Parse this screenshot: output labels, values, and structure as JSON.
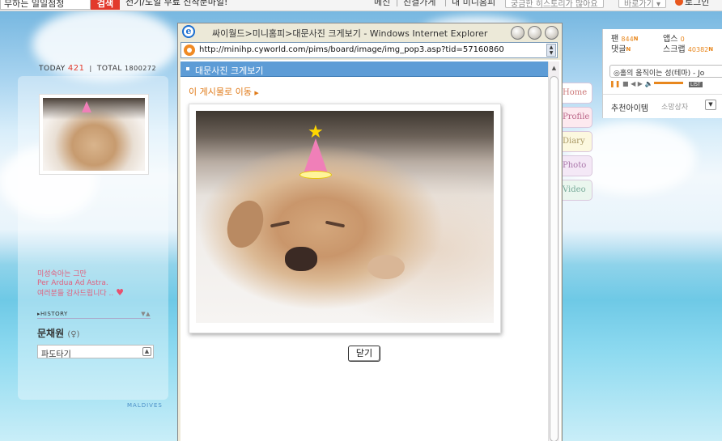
{
  "topbar": {
    "search_value": "무하는 일일점정",
    "search_button": "검색",
    "promo": "전기/도일 무료 신작문마일!",
    "links": [
      "메신",
      "친결가게",
      "내 미니홈피"
    ],
    "story_button": "궁금한 히스토리가 많아요",
    "shortcut_button": "바로가기 ▾",
    "login": "로그인"
  },
  "profile": {
    "today_label": "TODAY",
    "today_count": "421",
    "total_label": "TOTAL",
    "total_count": "1800272",
    "intro_line1": "미성숙아는 그만",
    "intro_line2": "Per Ardua Ad Astra.",
    "intro_line3": "여러분들 감사드립니다 ..",
    "history_label": "HISTORY",
    "owner_name": "문채원",
    "owner_gender": "(♀)",
    "wave_select": "파도타기",
    "skin_label": "MALDIVES"
  },
  "side_tabs": [
    "Home",
    "Profile",
    "Diary",
    "Photo",
    "Video"
  ],
  "right_widget": {
    "fan_label": "팬",
    "fan_count": "844",
    "apps_label": "앱스",
    "apps_count": "0",
    "comment_label": "댓글",
    "scrap_label": "스크랩",
    "scrap_count": "40382",
    "new_badge": "N",
    "bgm_title": "◎홀의 움직이는 성(테마) - Jo",
    "player_list": "LIST",
    "recommend_label": "추천아이템",
    "recommend_sub": "소망상자"
  },
  "popup": {
    "title": "싸이월드>미니홈피>대문사진 크게보기 - Windows Internet Explorer",
    "url": "http://minihp.cyworld.com/pims/board/image/img_pop3.asp?tid=57160860",
    "header": "대문사진 크게보기",
    "goto_link": "이 게시물로 이동",
    "close_button": "닫기"
  }
}
